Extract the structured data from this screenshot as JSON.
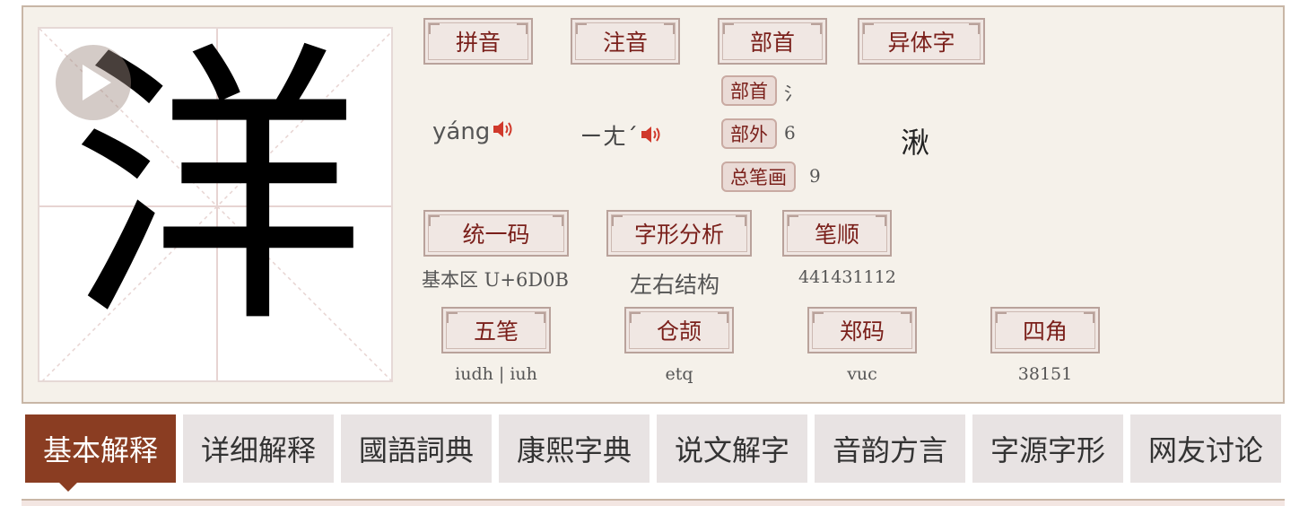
{
  "character": "洋",
  "labels": {
    "pinyin": "拼音",
    "zhuyin": "注音",
    "radical_section": "部首",
    "variant": "异体字",
    "unicode": "统一码",
    "structure": "字形分析",
    "stroke_order": "笔顺",
    "wubi": "五笔",
    "cangjie": "仓颉",
    "zhengma": "郑码",
    "sijiao": "四角"
  },
  "values": {
    "pinyin": "yáng",
    "zhuyin": "ㄧㄤˊ",
    "variant": "湫",
    "unicode": "基本区 U+6D0B",
    "structure": "左右结构",
    "stroke_order": "441431112",
    "wubi": "iudh | iuh",
    "cangjie": "etq",
    "zhengma": "vuc",
    "sijiao": "38151"
  },
  "radical_info": {
    "radical_label": "部首",
    "radical_value": "氵",
    "outer_label": "部外",
    "outer_value": "6",
    "total_label": "总笔画",
    "total_value": "9"
  },
  "icons": {
    "play": "play-icon",
    "speaker": "speaker-icon"
  },
  "tabs": [
    {
      "label": "基本解释",
      "active": true
    },
    {
      "label": "详细解释",
      "active": false
    },
    {
      "label": "國語詞典",
      "active": false
    },
    {
      "label": "康熙字典",
      "active": false
    },
    {
      "label": "说文解字",
      "active": false
    },
    {
      "label": "音韵方言",
      "active": false
    },
    {
      "label": "字源字形",
      "active": false
    },
    {
      "label": "网友讨论",
      "active": false
    }
  ],
  "colors": {
    "accent": "#8a3d22",
    "label_text": "#7a1f1a",
    "speaker": "#d0392b"
  }
}
